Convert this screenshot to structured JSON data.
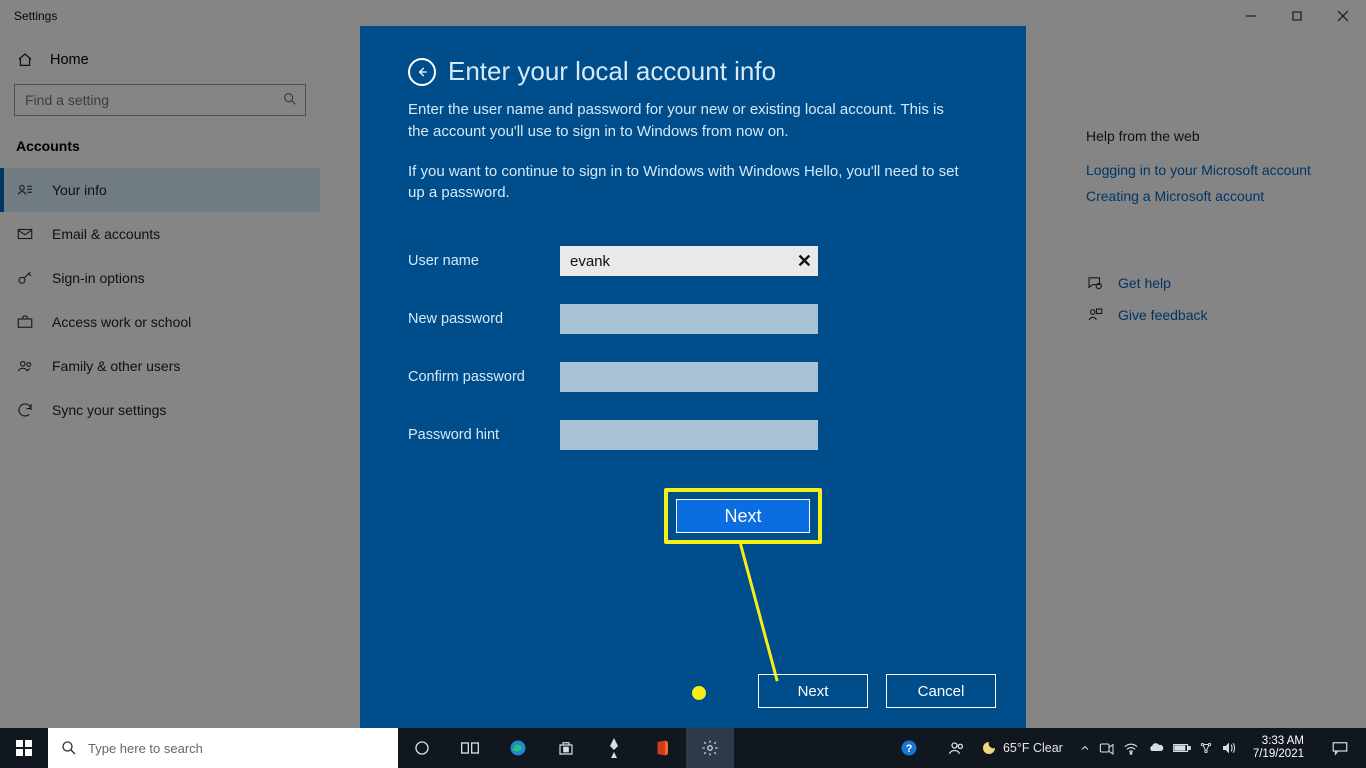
{
  "window": {
    "title": "Settings"
  },
  "settings": {
    "home": "Home",
    "search_placeholder": "Find a setting",
    "category": "Accounts",
    "nav": [
      {
        "label": "Your info"
      },
      {
        "label": "Email & accounts"
      },
      {
        "label": "Sign-in options"
      },
      {
        "label": "Access work or school"
      },
      {
        "label": "Family & other users"
      },
      {
        "label": "Sync your settings"
      }
    ]
  },
  "help": {
    "heading": "Help from the web",
    "links": [
      "Logging in to your Microsoft account",
      "Creating a Microsoft account"
    ],
    "get_help": "Get help",
    "feedback": "Give feedback"
  },
  "dialog": {
    "title": "Enter your local account info",
    "para1": "Enter the user name and password for your new or existing local account. This is the account you'll use to sign in to Windows from now on.",
    "para2": "If you want to continue to sign in to Windows with Windows Hello, you'll need to set up a password.",
    "labels": {
      "username": "User name",
      "new_password": "New password",
      "confirm_password": "Confirm password",
      "hint": "Password hint"
    },
    "values": {
      "username": "evank"
    },
    "next_highlight": "Next",
    "next": "Next",
    "cancel": "Cancel"
  },
  "taskbar": {
    "search_placeholder": "Type here to search",
    "weather": "65°F Clear",
    "time": "3:33 AM",
    "date": "7/19/2021"
  }
}
